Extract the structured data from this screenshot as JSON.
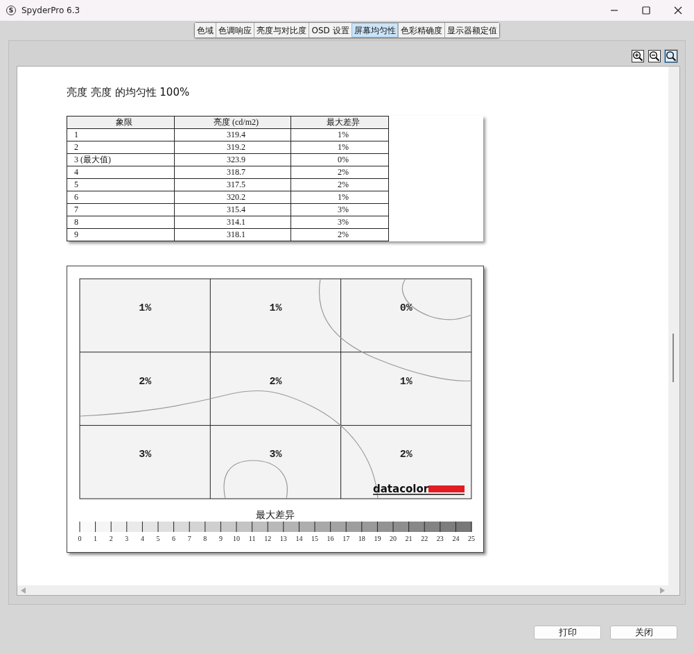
{
  "window": {
    "title": "SpyderPro 6.3",
    "icon_letter": "S"
  },
  "tabs": [
    {
      "label": "色域",
      "selected": false
    },
    {
      "label": "色调响应",
      "selected": false
    },
    {
      "label": "亮度与对比度",
      "selected": false
    },
    {
      "label": "OSD 设置",
      "selected": false
    },
    {
      "label": "屏幕均匀性",
      "selected": true
    },
    {
      "label": "色彩精确度",
      "selected": false
    },
    {
      "label": "显示器额定值",
      "selected": false
    }
  ],
  "zoom_tools": [
    {
      "kind": "zoom-in",
      "selected": false
    },
    {
      "kind": "zoom-out",
      "selected": false
    },
    {
      "kind": "zoom-fit",
      "selected": true
    }
  ],
  "report": {
    "heading": "亮度 亮度 的均匀性 100%",
    "table": {
      "columns": [
        "象限",
        "亮度 (cd/m2)",
        "最大差异"
      ],
      "rows": [
        [
          "1",
          "319.4",
          "1%"
        ],
        [
          "2",
          "319.2",
          "1%"
        ],
        [
          "3 (最大值)",
          "323.9",
          "0%"
        ],
        [
          "4",
          "318.7",
          "2%"
        ],
        [
          "5",
          "317.5",
          "2%"
        ],
        [
          "6",
          "320.2",
          "1%"
        ],
        [
          "7",
          "315.4",
          "3%"
        ],
        [
          "8",
          "314.1",
          "3%"
        ],
        [
          "9",
          "318.1",
          "2%"
        ]
      ]
    },
    "uniformity_map": {
      "cells": [
        [
          "1%",
          "1%",
          "0%"
        ],
        [
          "2%",
          "2%",
          "1%"
        ],
        [
          "3%",
          "3%",
          "2%"
        ]
      ],
      "logo_text": "datacolor",
      "legend_title": "最大差异",
      "legend_ticks": [
        "0",
        "1",
        "2",
        "3",
        "4",
        "5",
        "6",
        "7",
        "8",
        "9",
        "10",
        "11",
        "12",
        "13",
        "14",
        "15",
        "16",
        "17",
        "18",
        "19",
        "20",
        "21",
        "22",
        "23",
        "24",
        "25"
      ]
    }
  },
  "buttons": [
    "打印",
    "关闭"
  ]
}
